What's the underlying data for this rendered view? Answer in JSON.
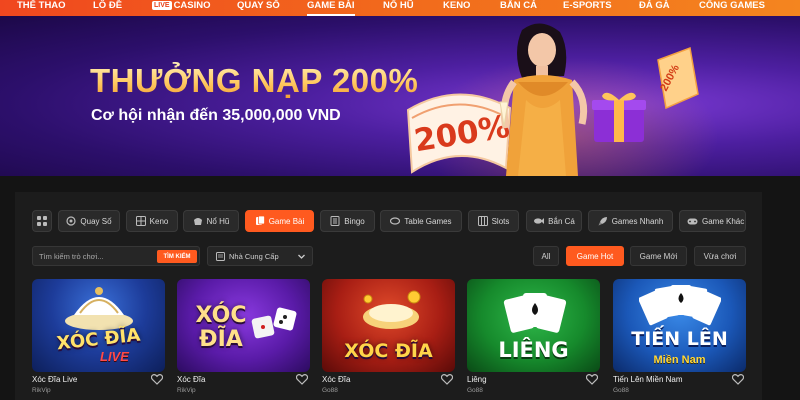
{
  "nav": {
    "items": [
      {
        "label": "THỂ THAO"
      },
      {
        "label": "LÔ ĐỀ"
      },
      {
        "label": "CASINO",
        "badge": "LIVE"
      },
      {
        "label": "QUAY SỐ"
      },
      {
        "label": "GAME BÀI",
        "active": true
      },
      {
        "label": "NỔ HŨ"
      },
      {
        "label": "KENO"
      },
      {
        "label": "BẮN CÁ"
      },
      {
        "label": "E-SPORTS"
      },
      {
        "label": "ĐÁ GÀ"
      },
      {
        "label": "CỔNG GAMES"
      }
    ]
  },
  "banner": {
    "title": "THƯỞNG NẠP 200%",
    "subtitle": "Cơ hội nhận đến 35,000,000 VND",
    "ribbon_text": "200%",
    "ticket_text": "200%"
  },
  "categories": [
    {
      "label": "",
      "icon": "grid-icon"
    },
    {
      "label": "Quay Số",
      "icon": "lottery-icon"
    },
    {
      "label": "Keno",
      "icon": "keno-icon"
    },
    {
      "label": "Nổ Hũ",
      "icon": "jackpot-icon"
    },
    {
      "label": "Game Bài",
      "icon": "cards-icon",
      "active": true
    },
    {
      "label": "Bingo",
      "icon": "bingo-icon"
    },
    {
      "label": "Table Games",
      "icon": "table-games-icon"
    },
    {
      "label": "Slots",
      "icon": "slots-icon"
    },
    {
      "label": "Bắn Cá",
      "icon": "fish-icon"
    },
    {
      "label": "Games Nhanh",
      "icon": "rocket-icon"
    },
    {
      "label": "Game Khác",
      "icon": "gamepad-icon"
    }
  ],
  "search": {
    "placeholder": "Tìm kiếm trò chơi...",
    "value": "",
    "button_label": "TÌM KIẾM"
  },
  "provider_select": {
    "label": "Nhà Cung Cấp"
  },
  "filters": [
    {
      "label": "All"
    },
    {
      "label": "Game Hot",
      "active": true
    },
    {
      "label": "Game Mới"
    },
    {
      "label": "Vừa chơi"
    }
  ],
  "games": [
    {
      "name": "Xóc Đĩa Live",
      "provider": "RikVip",
      "art_title": "XÓC ĐĨA",
      "art_sub": "LIVE"
    },
    {
      "name": "Xóc Đĩa",
      "provider": "RikVip",
      "art_title": "XÓC ĐĨA",
      "art_sub": ""
    },
    {
      "name": "Xóc Đĩa",
      "provider": "Go88",
      "art_title": "XÓC ĐĨA",
      "art_sub": ""
    },
    {
      "name": "Liêng",
      "provider": "Go88",
      "art_title": "LIÊNG",
      "art_sub": ""
    },
    {
      "name": "Tiến Lên Miền Nam",
      "provider": "Go88",
      "art_title": "TIẾN LÊN",
      "art_sub": "Miền Nam"
    }
  ],
  "colors": {
    "accent": "#ff5a1f",
    "nav_gradient_start": "#f0471f",
    "nav_gradient_end": "#f4851f",
    "panel_bg": "#1c1c1c"
  }
}
